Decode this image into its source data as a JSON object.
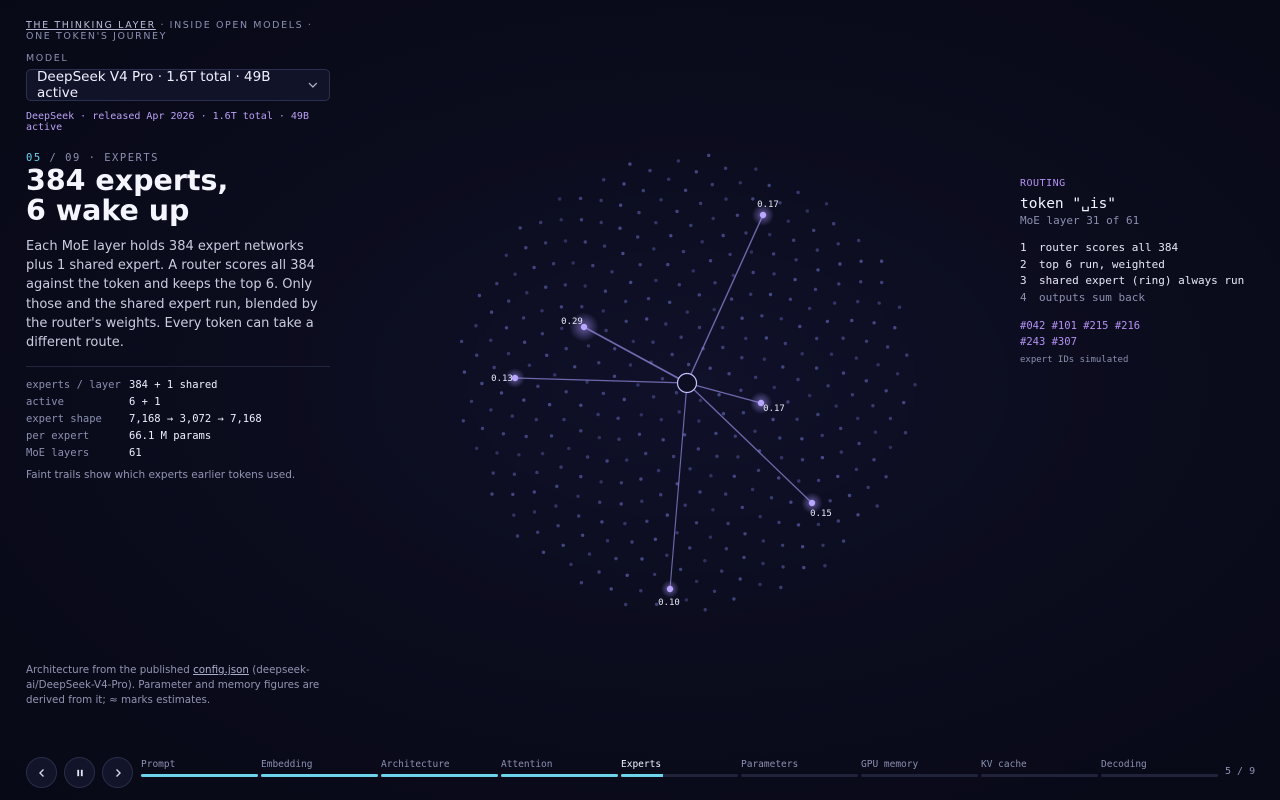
{
  "brand": {
    "link": "THE THINKING LAYER",
    "rest": " · INSIDE OPEN MODELS · ONE TOKEN'S JOURNEY"
  },
  "model": {
    "label": "MODEL",
    "selected": "DeepSeek V4 Pro · 1.6T total · 49B active",
    "meta": "DeepSeek · released Apr 2026 · 1.6T total · 49B active"
  },
  "step": {
    "current": "05",
    "rest": " / 09 · EXPERTS"
  },
  "headline": {
    "line1": "384 experts,",
    "line2": "6 wake up"
  },
  "description": "Each MoE layer holds 384 expert networks plus 1 shared expert. A router scores all 384 against the token and keeps the top 6. Only those and the shared expert run, blended by the router's weights. Every token can take a different route.",
  "stats": [
    {
      "key": "experts / layer",
      "value": "384 + 1 shared"
    },
    {
      "key": "active",
      "value": "6 + 1"
    },
    {
      "key": "expert shape",
      "value": "7,168 → 3,072 → 7,168"
    },
    {
      "key": "per expert",
      "value": "66.1 M params"
    },
    {
      "key": "MoE layers",
      "value": "61"
    }
  ],
  "trail_note": "Faint trails show which experts earlier tokens used.",
  "footnote": {
    "pre": "Architecture from the published ",
    "link": "config.json",
    "post": " (deepseek-ai/DeepSeek-V4-Pro). Parameter and memory figures are derived from it; ≈ marks estimates."
  },
  "routing": {
    "heading": "ROUTING",
    "token": "token \"␣is\"",
    "layer": "MoE layer 31 of 61",
    "steps": [
      {
        "n": "1",
        "text": "router scores all 384"
      },
      {
        "n": "2",
        "text": "top 6 run, weighted"
      },
      {
        "n": "3",
        "text": "shared expert (ring) always run"
      },
      {
        "n": "4",
        "text": "outputs sum back"
      }
    ],
    "expert_ids": "#042 #101 #215 #216 #243 #307",
    "simulated_note": "expert IDs simulated"
  },
  "experts_viz": {
    "total_experts": 384,
    "active": [
      {
        "id": "#042",
        "weight": "0.17"
      },
      {
        "id": "#101",
        "weight": "0.29"
      },
      {
        "id": "#215",
        "weight": "0.13"
      },
      {
        "id": "#216",
        "weight": "0.17"
      },
      {
        "id": "#243",
        "weight": "0.15"
      },
      {
        "id": "#307",
        "weight": "0.10"
      }
    ],
    "colors": {
      "dot": "#4b4f8f",
      "active": "#b9a7ff",
      "line": "#8f86d8"
    }
  },
  "nav": {
    "prev_icon": "chevron-left-icon",
    "pause_icon": "pause-icon",
    "next_icon": "chevron-right-icon",
    "steps": [
      {
        "label": "Prompt",
        "progress": 1.0
      },
      {
        "label": "Embedding",
        "progress": 1.0
      },
      {
        "label": "Architecture",
        "progress": 1.0
      },
      {
        "label": "Attention",
        "progress": 1.0
      },
      {
        "label": "Experts",
        "progress": 0.36
      },
      {
        "label": "Parameters",
        "progress": 0
      },
      {
        "label": "GPU memory",
        "progress": 0
      },
      {
        "label": "KV cache",
        "progress": 0
      },
      {
        "label": "Decoding",
        "progress": 0
      }
    ],
    "pager": "5 / 9",
    "accent": "#6dd3ea"
  }
}
